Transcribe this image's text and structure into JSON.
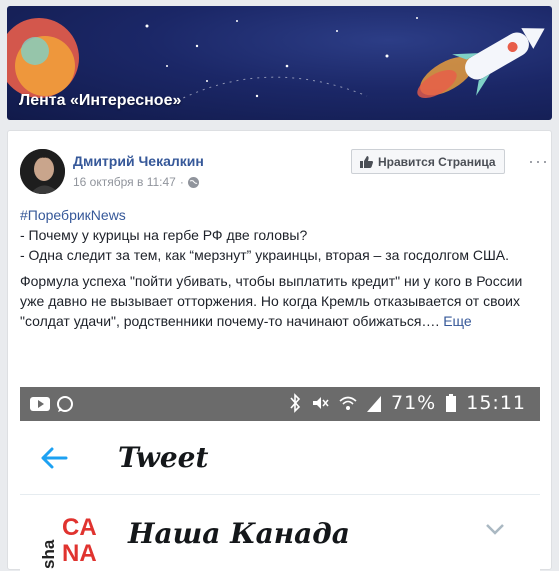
{
  "banner": {
    "title": "Лента «Интересное»"
  },
  "post": {
    "author": "Дмитрий Чекалкин",
    "date": "16 октября в 11:47",
    "separator": "·",
    "like_page_label": "Нравится Страница",
    "more": "···",
    "hashtag": "#ПоребрикNews",
    "line1": "- Почему у курицы на гербе РФ две головы?",
    "line2": "- Одна следит за тем, как “мерзнут” украинцы, вторая – за госдолгом США.",
    "para2": "Формула успеха \"пойти убивать, чтобы выплатить кредит\" ни у кого в России уже давно не вызывает отторжения. Но когда Кремль отказывается от своих \"солдат удачи\", родственники почему-то начинают обижаться….",
    "see_more": "Еще"
  },
  "screenshot": {
    "status_battery": "71%",
    "status_time": "15:11",
    "tweet_title": "Tweet",
    "account_name": "Наша Канада",
    "logo_text_1": "sha",
    "logo_text_2": "CA",
    "logo_text_3": "NA"
  },
  "colors": {
    "link": "#365899",
    "banner_bg": "#1b2767",
    "statusbar": "#6b6b6b",
    "twitter_blue": "#1da1f2"
  }
}
